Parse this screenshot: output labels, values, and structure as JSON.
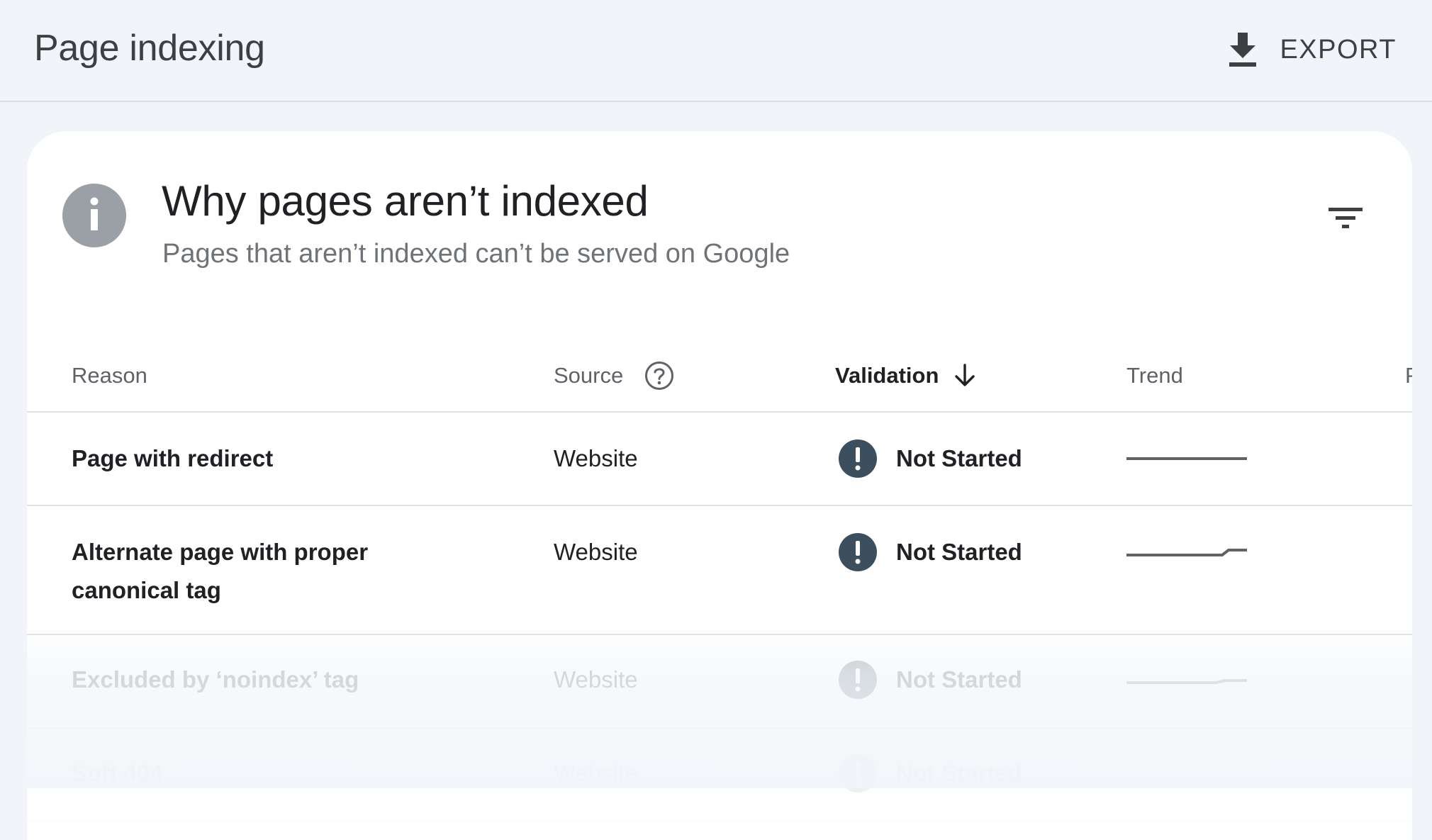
{
  "header": {
    "title": "Page indexing",
    "export_label": "EXPORT",
    "export_icon": "download-icon"
  },
  "card": {
    "title": "Why pages aren’t indexed",
    "subtitle": "Pages that aren’t indexed can’t be served on Google",
    "info_icon": "info-icon",
    "filter_icon": "filter-icon"
  },
  "table": {
    "columns": {
      "reason": "Reason",
      "source": "Source",
      "validation": "Validation",
      "trend": "Trend",
      "extra": "P"
    },
    "sorted_by": "Validation",
    "sort_direction": "descending",
    "rows": [
      {
        "reason": "Page with redirect",
        "source": "Website",
        "validation": "Not Started"
      },
      {
        "reason": "Alternate page with proper canonical tag",
        "source": "Website",
        "validation": "Not Started"
      },
      {
        "reason": "Excluded by ‘noindex’ tag",
        "source": "Website",
        "validation": "Not Started"
      },
      {
        "reason": "Soft 404",
        "source": "Website",
        "validation": "Not Started"
      }
    ]
  },
  "colors": {
    "background": "#f1f4f9",
    "card": "#ffffff",
    "status_icon": "#3c4f5f",
    "info_icon": "#9aa0a6",
    "text_primary": "#202124",
    "text_secondary": "#6f7378"
  }
}
